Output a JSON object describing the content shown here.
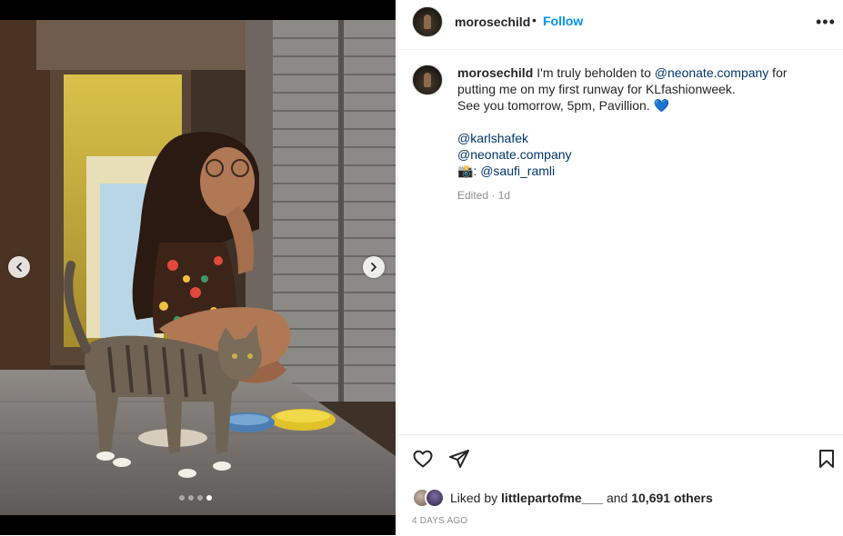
{
  "post": {
    "username": "morosechild",
    "bullet": "•",
    "follow_label": "Follow",
    "more_label": "•••"
  },
  "caption": {
    "username": "morosechild",
    "line1_pre": "I'm truly beholden to ",
    "mention1": "@neonate.company",
    "line1_post": " for putting me on my first runway for KLfashionweek.",
    "line2": "See you tomorrow, 5pm, Pavillion.",
    "line2_emoji": "💙",
    "mention_karl": "@karlshafek",
    "mention_neonate": "@neonate.company",
    "camera_prefix": "📸: ",
    "mention_saufi": "@saufi_ramli",
    "edited": "Edited",
    "dot": "·",
    "age": "1d"
  },
  "likes": {
    "prefix": "Liked by ",
    "liker": "littlepartofme___",
    "middle": " and ",
    "count": "10,691 others"
  },
  "date": "4 DAYS AGO",
  "carousel": {
    "slides": 4,
    "active_index": 3
  },
  "icons": {
    "like": "heart-outline-icon",
    "share": "paper-plane-icon",
    "save": "bookmark-outline-icon",
    "prev": "chevron-left-icon",
    "next": "chevron-right-icon"
  },
  "colors": {
    "follow": "#0095f6",
    "mention": "#00376b",
    "meta": "#8e8e8e",
    "heart_emoji": "#1877f2"
  }
}
